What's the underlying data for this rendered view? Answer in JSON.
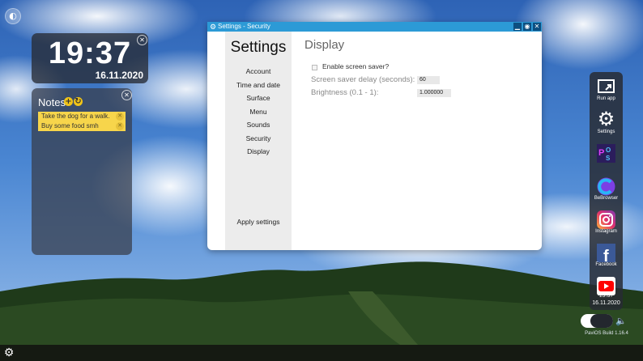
{
  "desktop": {
    "taskbar": {
      "settings_icon": "gear-icon"
    },
    "orb_icon": "globe-icon"
  },
  "clock_widget": {
    "time": "19:37",
    "date": "16.11.2020",
    "close_icon": "close-icon"
  },
  "notes_widget": {
    "title": "Notes",
    "add_icon": "plus-icon",
    "refresh_icon": "refresh-icon",
    "notes": [
      {
        "text": "Take the dog for a walk."
      },
      {
        "text": "Buy some food smh"
      }
    ]
  },
  "settings_window": {
    "title": "Settings - Security",
    "sidebar_title": "Settings",
    "menu": [
      "Account",
      "Time and date",
      "Surface",
      "Menu",
      "Sounds",
      "Security",
      "Display"
    ],
    "apply_label": "Apply settings",
    "content": {
      "heading": "Display",
      "screen_saver_label": "Enable screen saver?",
      "screen_saver_enabled": false,
      "delay_label": "Screen saver delay (seconds):",
      "delay_value": "60",
      "brightness_label": "Brightness (0.1 - 1):",
      "brightness_value": "1.000000"
    }
  },
  "dock": {
    "apps": [
      {
        "label": "Run app",
        "icon": "run-app-icon"
      },
      {
        "label": "Settings",
        "icon": "gear-icon"
      },
      {
        "label": "",
        "icon": "pavios-logo-icon"
      },
      {
        "label": "BeBrowser",
        "icon": "browser-icon"
      },
      {
        "label": "Instagram",
        "icon": "instagram-icon"
      },
      {
        "label": "Facebook",
        "icon": "facebook-icon"
      },
      {
        "label": "",
        "icon": "youtube-icon"
      }
    ],
    "clock_time": "19:37",
    "clock_date": "16.11.2020",
    "build": "PaviOS Build 1.16.4",
    "volume_icon": "speaker-icon"
  },
  "colors": {
    "titlebar": "#2c9ad6",
    "note": "#f7d54b",
    "instagram": "#c13584",
    "facebook": "#3b5998",
    "youtube": "#ff0000"
  }
}
